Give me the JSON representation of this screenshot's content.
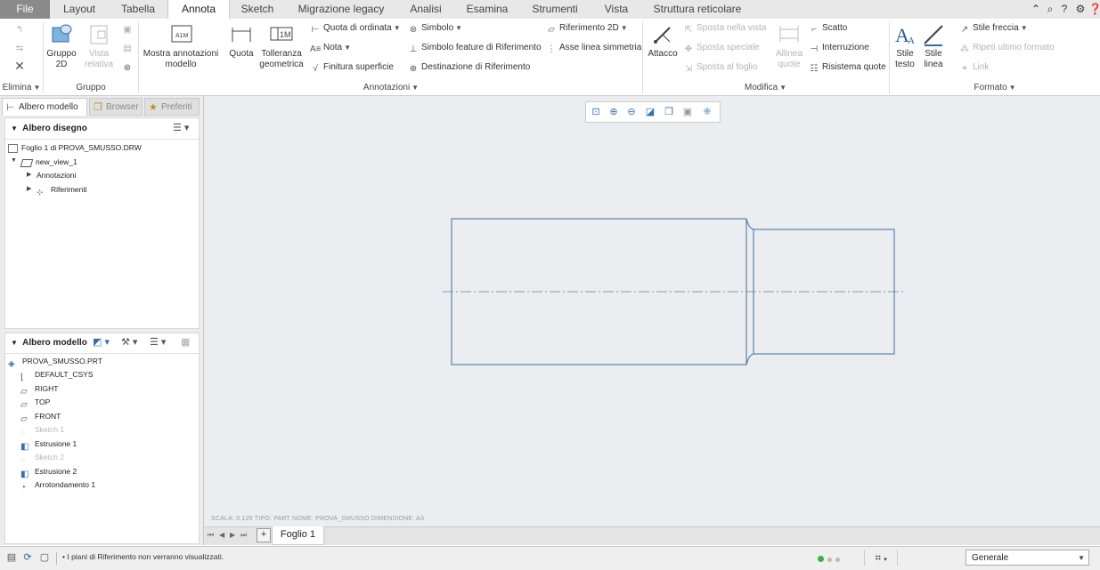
{
  "menubar": {
    "tabs": [
      "File",
      "Layout",
      "Tabella",
      "Annota",
      "Sketch",
      "Migrazione legacy",
      "Analisi",
      "Esamina",
      "Strumenti",
      "Vista",
      "Struttura reticolare"
    ],
    "active": "Annota"
  },
  "ribbon": {
    "groups": {
      "elimina": "Elimina",
      "gruppo": "Gruppo",
      "annotazioni": "Annotazioni",
      "modifica": "Modifica",
      "formato": "Formato"
    },
    "gruppo2d": "Gruppo 2D",
    "vista_relativa": "Vista relativa",
    "mostra_annotazioni": "Mostra annotazioni modello",
    "quota": "Quota",
    "tolleranza": "Tolleranza geometrica",
    "quota_ordinata": "Quota di ordinata",
    "nota": "Nota",
    "finitura": "Finitura superficie",
    "simbolo": "Simbolo",
    "simbolo_feature": "Simbolo feature di Riferimento",
    "destinazione": "Destinazione di Riferimento",
    "riferimento2d": "Riferimento 2D",
    "asse_linea": "Asse linea simmetria",
    "attacco": "Attacco",
    "sposta_vista": "Sposta nella vista",
    "sposta_speciale": "Sposta speciale",
    "sposta_foglio": "Sposta al foglio",
    "allinea_quote": "Allinea quote",
    "scatto": "Scatto",
    "interruzione": "Interruzione",
    "risistema": "Risistema quote",
    "stile_testo": "Stile testo",
    "stile_linea": "Stile linea",
    "stile_freccia": "Stile freccia",
    "ripeti": "Ripeti ultimo formato",
    "link": "Link"
  },
  "panel": {
    "tabs": [
      "Albero modello",
      "Browser",
      "Preferiti"
    ],
    "drawing_tree": {
      "title": "Albero disegno",
      "sheet": "Foglio 1 di PROVA_SMUSSO.DRW",
      "view": "new_view_1",
      "annotations": "Annotazioni",
      "references": "Riferimenti"
    },
    "model_tree": {
      "title": "Albero modello",
      "items": [
        "PROVA_SMUSSO.PRT",
        "DEFAULT_CSYS",
        "RIGHT",
        "TOP",
        "FRONT",
        "Sketch 1",
        "Estrusione 1",
        "Sketch 2",
        "Estrusione 2",
        "Arrotondamento 1"
      ]
    }
  },
  "canvas": {
    "status": "SCALA: 0.125    TIPO: PART    NOME: PROVA_SMUSSO    DIMENSIONE: A3"
  },
  "sheetbar": {
    "add": "+",
    "sheet": "Foglio 1"
  },
  "status": {
    "message": "I piani di Riferimento non verranno visualizzati.",
    "filter": "Generale"
  }
}
